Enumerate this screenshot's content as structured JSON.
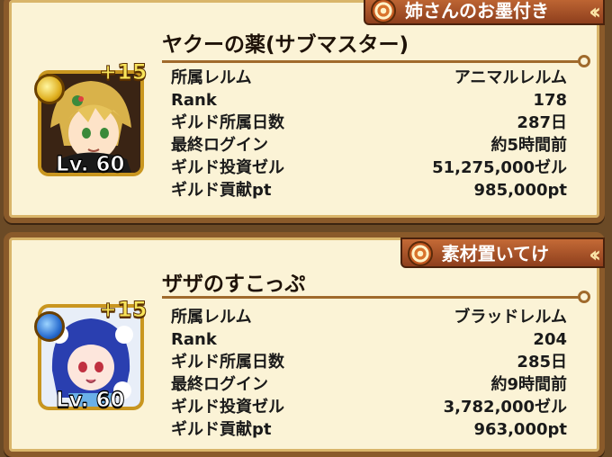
{
  "labels": {
    "realm": "所属レルム",
    "rank": "Rank",
    "days": "ギルド所属日数",
    "login": "最終ログイン",
    "invest": "ギルド投資ゼル",
    "contrib": "ギルド貢献pt"
  },
  "members": [
    {
      "tab_title": "姉さんのお墨付き",
      "name": "ヤクーの薬(サブマスター)",
      "plus": "+15",
      "level": "Lv. 60",
      "orb_icon": "yellow-star-orb-icon",
      "realm": "アニマルレルム",
      "rank": "178",
      "days": "287日",
      "login": "約5時間前",
      "invest": "51,275,000ゼル",
      "contrib": "985,000pt"
    },
    {
      "tab_title": "素材置いてけ",
      "name": "ザザのすこっぷ",
      "plus": "+15",
      "level": "Lv. 60",
      "orb_icon": "blue-water-orb-icon",
      "realm": "ブラッドレルム",
      "rank": "204",
      "days": "285日",
      "login": "約9時間前",
      "invest": "3,782,000ゼル",
      "contrib": "963,000pt"
    }
  ]
}
